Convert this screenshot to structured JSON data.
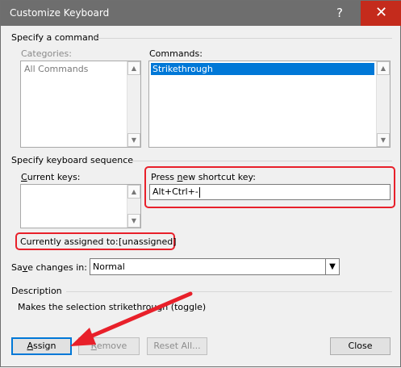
{
  "window": {
    "title": "Customize Keyboard",
    "help_glyph": "?",
    "close_glyph": "✕"
  },
  "command_group": {
    "label": "Specify a command",
    "categories_label": "Categories:",
    "categories": [
      "All Commands"
    ],
    "commands_label": "Commands:",
    "commands": [
      "Strikethrough"
    ]
  },
  "keyboard_group": {
    "label": "Specify keyboard sequence",
    "current_keys_label_pre": "",
    "current_keys_label_u": "C",
    "current_keys_label_post": "urrent keys:",
    "new_key_label_pre": "Press ",
    "new_key_label_u": "n",
    "new_key_label_post": "ew shortcut key:",
    "new_key_value": "Alt+Ctrl+-"
  },
  "assigned": {
    "label": "Currently assigned to:",
    "value": "[unassigned]"
  },
  "save": {
    "label_pre": "Sa",
    "label_u": "v",
    "label_post": "e changes in:",
    "selected": "Normal"
  },
  "description": {
    "label": "Description",
    "text": "Makes the selection strikethrough (toggle)"
  },
  "buttons": {
    "assign_u": "A",
    "assign_rest": "ssign",
    "remove_u": "R",
    "remove_rest": "emove",
    "reset": "Reset All...",
    "close": "Close"
  },
  "colors": {
    "highlight": "#e8202a",
    "selection": "#0078d7",
    "titlebar": "#6e6e6e",
    "close_red": "#c42b1c"
  }
}
